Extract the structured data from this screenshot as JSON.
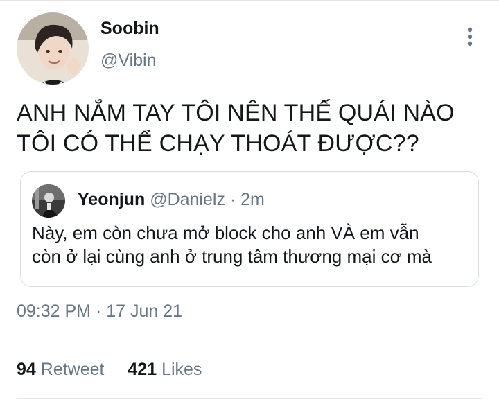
{
  "author": {
    "display_name": "Soobin",
    "handle": "@Vibin",
    "avatar_icon": "profile-photo"
  },
  "tweet": {
    "text_lines": [
      "ANH NẮM TAY TÔI NÊN THẾ QUÁI NÀO",
      "TÔI CÓ THỂ CHẠY THOÁT ĐƯỢC??"
    ],
    "timestamp": "09:32 PM · 17 Jun 21"
  },
  "quoted_tweet": {
    "display_name": "Yeonjun",
    "handle_time": "@Danielz · 2m",
    "avatar_icon": "profile-photo",
    "text_lines": [
      "Này, em còn chưa mở block cho anh VÀ em vẫn",
      "còn ở lại cùng anh ở trung tâm thương mại cơ mà"
    ]
  },
  "stats": {
    "retweet_count": "94",
    "retweet_label": "Retweet",
    "likes_count": "421",
    "likes_label": "Likes"
  },
  "menu_icon": "more-vertical-icon",
  "colors": {
    "primary_text": "#14171a",
    "secondary_text": "#657786",
    "border": "#d6dde3"
  }
}
